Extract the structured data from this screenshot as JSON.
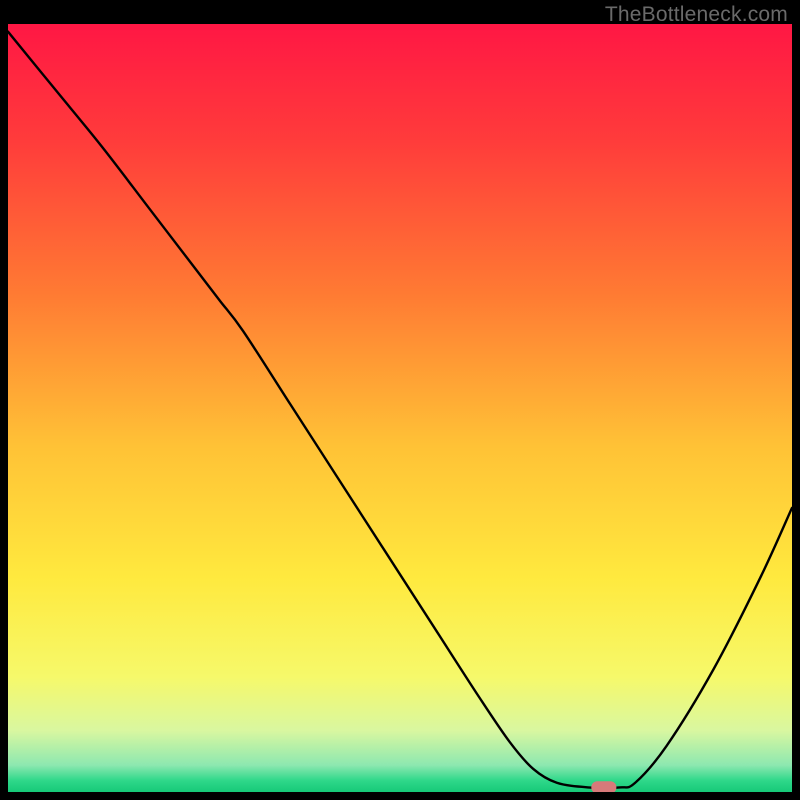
{
  "watermark": "TheBottleneck.com",
  "chart_data": {
    "type": "line",
    "title": "",
    "xlabel": "",
    "ylabel": "",
    "xlim": [
      0,
      100
    ],
    "ylim": [
      0,
      100
    ],
    "gradient_stops": [
      {
        "offset": 0.0,
        "color": "#ff1744"
      },
      {
        "offset": 0.15,
        "color": "#ff3b3b"
      },
      {
        "offset": 0.35,
        "color": "#ff7a33"
      },
      {
        "offset": 0.55,
        "color": "#ffc236"
      },
      {
        "offset": 0.72,
        "color": "#ffe93e"
      },
      {
        "offset": 0.85,
        "color": "#f6f96a"
      },
      {
        "offset": 0.92,
        "color": "#d9f7a0"
      },
      {
        "offset": 0.965,
        "color": "#8de8b0"
      },
      {
        "offset": 0.985,
        "color": "#2fd88a"
      },
      {
        "offset": 1.0,
        "color": "#16c978"
      }
    ],
    "series": [
      {
        "name": "bottleneck-curve",
        "color": "#000000",
        "x": [
          0.0,
          6.0,
          12.0,
          18.0,
          24.0,
          27.0,
          30.0,
          36.0,
          42.0,
          48.0,
          54.0,
          60.0,
          64.0,
          67.0,
          70.0,
          74.0,
          78.0,
          80.0,
          84.0,
          90.0,
          96.0,
          100.0
        ],
        "y": [
          99.0,
          91.5,
          84.0,
          76.0,
          68.0,
          64.0,
          60.0,
          50.5,
          41.0,
          31.5,
          22.0,
          12.5,
          6.5,
          3.0,
          1.2,
          0.6,
          0.6,
          1.2,
          6.0,
          16.0,
          28.0,
          37.0
        ]
      }
    ],
    "marker": {
      "name": "bottleneck-marker",
      "x": 76.0,
      "y": 0.6,
      "width": 3.2,
      "height": 1.6,
      "color": "#d77a7a"
    }
  }
}
